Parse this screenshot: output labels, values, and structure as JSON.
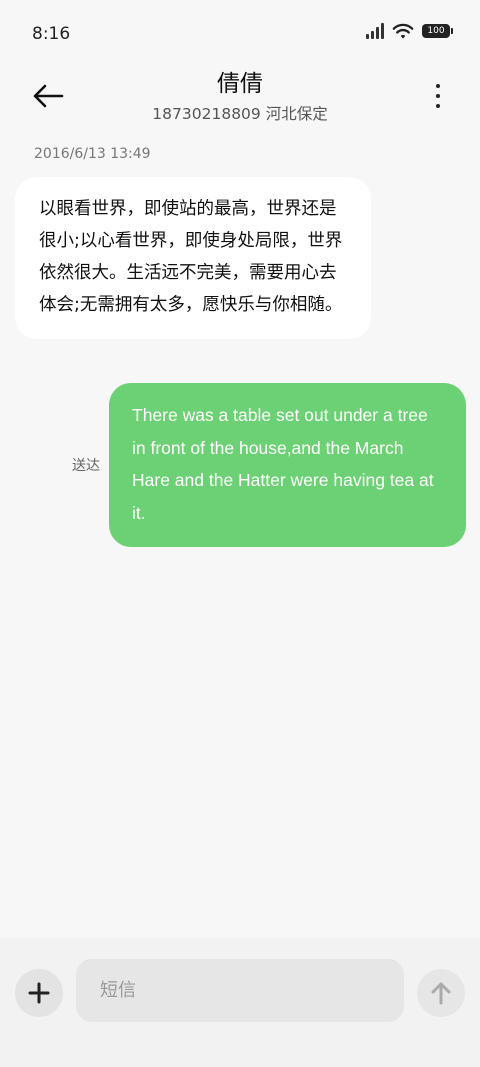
{
  "status_bar": {
    "time": "8:16",
    "battery_level": "100",
    "icons": [
      "signal-icon",
      "wifi-icon",
      "battery-icon"
    ]
  },
  "header": {
    "contact_name": "倩倩",
    "contact_info": "18730218809 河北保定",
    "icons": [
      "back-arrow-icon",
      "more-vertical-icon"
    ]
  },
  "conversation": {
    "timestamp": "2016/6/13 13:49",
    "incoming_message": "以眼看世界，即使站的最高，世界还是很小;以心看世界，即使身处局限，世界依然很大。生活远不完美，需要用心去体会;无需拥有太多，愿快乐与你相随。",
    "outgoing_message": "There was a table set out under a tree in front of the house,and the March Hare and the Hatter were having tea at it.",
    "outgoing_status": "送达"
  },
  "compose": {
    "placeholder": "短信",
    "value": "",
    "icons": [
      "plus-icon",
      "arrow-up-icon"
    ]
  },
  "colors": {
    "background": "#f7f7f7",
    "incoming_bubble": "#ffffff",
    "outgoing_bubble": "#6cd174"
  }
}
